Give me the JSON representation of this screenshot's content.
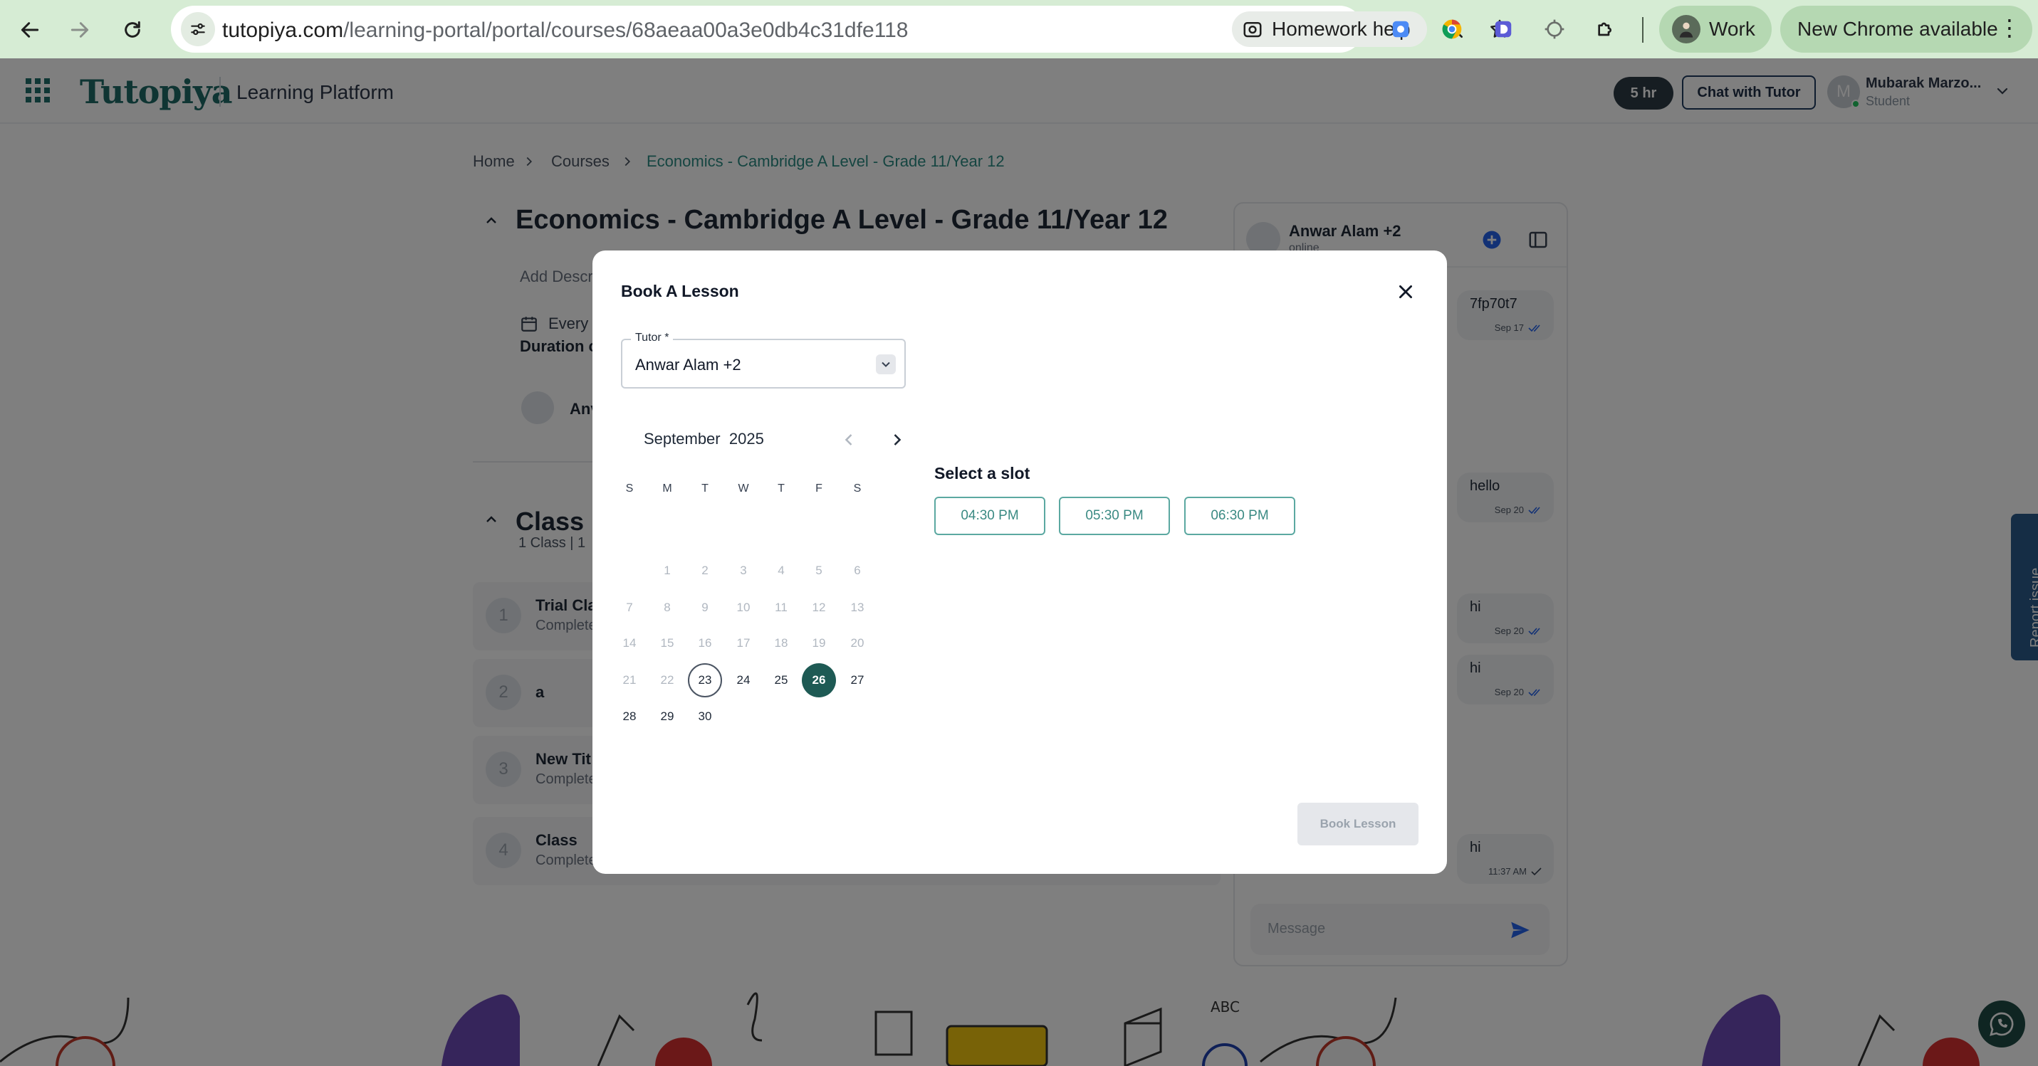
{
  "browser": {
    "url_domain": "tutopiya.com",
    "url_path": "/learning-portal/portal/courses/68aeaa00a3e0db4c31dfe118",
    "homework_chip": "Homework help",
    "profile_label": "Work",
    "update_label": "New Chrome available"
  },
  "header": {
    "logo": "Tutopiya",
    "platform": "Learning Platform",
    "hours_badge": "5 hr",
    "chat_tutor": "Chat with Tutor",
    "user_initial": "M",
    "user_name": "Mubarak Marzo...",
    "user_role": "Student"
  },
  "breadcrumb": [
    "Home",
    "Courses",
    "Economics - Cambridge A Level - Grade 11/Year 12"
  ],
  "course": {
    "title": "Economics - Cambridge A Level - Grade 11/Year 12",
    "add_description": "Add Descr",
    "schedule_partial": "Every",
    "duration_partial": "Duration c",
    "tutor_partial": "Anv"
  },
  "classes": {
    "title_partial": "Class D",
    "subtitle_partial": "1 Class | 1",
    "rows": [
      {
        "num": "1",
        "name": "Trial Cla",
        "status": "Complete"
      },
      {
        "num": "2",
        "name": "a",
        "status": ""
      },
      {
        "num": "3",
        "name": "New Tit",
        "status": "Complete"
      },
      {
        "num": "4",
        "name": "Class",
        "status": "Complete"
      }
    ]
  },
  "chat": {
    "name": "Anwar Alam +2",
    "status": "online",
    "messages": [
      {
        "text": "7fp70t7",
        "meta": "Sep 17"
      },
      {
        "text": "hello",
        "meta": "Sep 20"
      },
      {
        "text": "hi",
        "meta": "Sep 20"
      },
      {
        "text": "hi",
        "meta": "Sep 20"
      },
      {
        "text": "hi",
        "meta": "11:37 AM"
      }
    ],
    "placeholder": "Message"
  },
  "report_issue": "Report issue",
  "modal": {
    "title": "Book A Lesson",
    "tutor_label": "Tutor *",
    "tutor_value": "Anwar Alam +2",
    "calendar": {
      "month": "September",
      "year": "2025",
      "dow": [
        "S",
        "M",
        "T",
        "W",
        "T",
        "F",
        "S"
      ],
      "first_weekday": 1,
      "days_in_month": 30,
      "today": 23,
      "selected": 26,
      "enabled": [
        23,
        24,
        25,
        26,
        27,
        28,
        29,
        30
      ]
    },
    "slot_heading": "Select a slot",
    "slots": [
      "04:30 PM",
      "05:30 PM",
      "06:30 PM"
    ],
    "book_button": "Book Lesson"
  },
  "colors": {
    "brand": "#1e6b66",
    "selected_day": "#1e5a54",
    "slot_border": "#5ba8a1",
    "chrome": "#d6ecd4"
  }
}
